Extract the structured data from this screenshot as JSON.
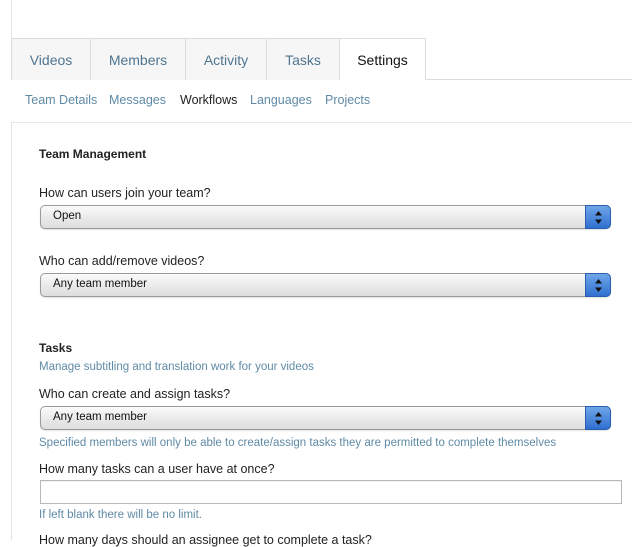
{
  "tabs": [
    {
      "label": "Videos"
    },
    {
      "label": "Members"
    },
    {
      "label": "Activity"
    },
    {
      "label": "Tasks"
    },
    {
      "label": "Settings",
      "active": true
    }
  ],
  "subnav": [
    {
      "label": "Team Details"
    },
    {
      "label": "Messages"
    },
    {
      "label": "Workflows",
      "active": true
    },
    {
      "label": "Languages"
    },
    {
      "label": "Projects"
    }
  ],
  "team_management": {
    "title": "Team Management",
    "join_label": "How can users join your team?",
    "join_value": "Open",
    "videos_label": "Who can add/remove videos?",
    "videos_value": "Any team member"
  },
  "tasks": {
    "title": "Tasks",
    "subtitle": "Manage subtitling and translation work for your videos",
    "assign_label": "Who can create and assign tasks?",
    "assign_value": "Any team member",
    "assign_help": "Specified members will only be able to create/assign tasks they are permitted to complete themselves",
    "limit_label": "How many tasks can a user have at once?",
    "limit_value": "",
    "limit_help": "If left blank there will be no limit.",
    "days_label": "How many days should an assignee get to complete a task?"
  },
  "colors": {
    "link": "#5f8aa6",
    "tab_text": "#4f7591",
    "stepper": "#2f6fd0"
  }
}
